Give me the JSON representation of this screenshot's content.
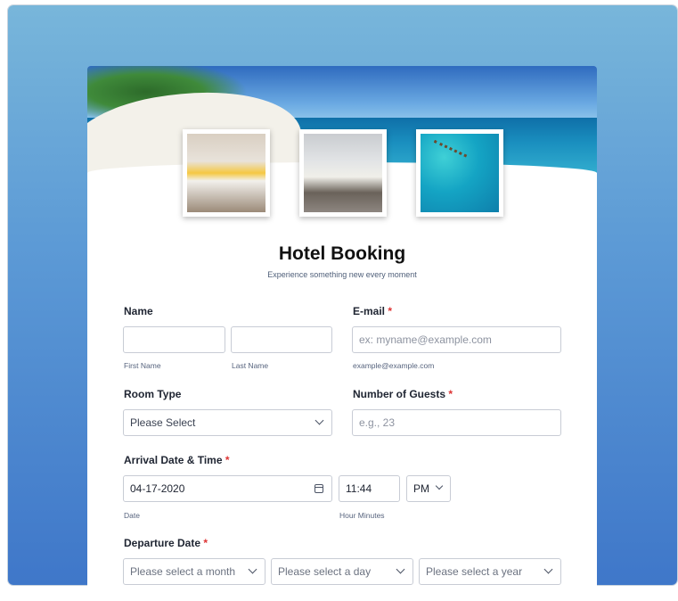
{
  "form": {
    "title": "Hotel Booking",
    "subtitle": "Experience something new every moment"
  },
  "images": {
    "hero_icon": "beach-banner",
    "thumb1_icon": "bedroom-photo",
    "thumb2_icon": "hotel-room-photo",
    "thumb3_icon": "overwater-bungalows-photo"
  },
  "name": {
    "label": "Name",
    "first_sublabel": "First Name",
    "last_sublabel": "Last Name",
    "first_value": "",
    "last_value": ""
  },
  "email": {
    "label": "E-mail",
    "required": "*",
    "placeholder": "ex: myname@example.com",
    "sublabel": "example@example.com"
  },
  "room_type": {
    "label": "Room Type",
    "selected": "Please Select"
  },
  "guests": {
    "label": "Number of Guests",
    "required": "*",
    "placeholder": "e.g., 23"
  },
  "arrival": {
    "label": "Arrival Date & Time",
    "required": "*",
    "date_value": "04-17-2020",
    "date_sublabel": "Date",
    "time_value": "11:44",
    "time_sublabel": "Hour Minutes",
    "ampm": "PM"
  },
  "departure": {
    "label": "Departure Date",
    "required": "*",
    "month_placeholder": "Please select a month",
    "day_placeholder": "Please select a day",
    "year_placeholder": "Please select a year"
  },
  "colors": {
    "required": "#dd3333",
    "background_top": "#78b6da",
    "background_bottom": "#3f77c9"
  }
}
